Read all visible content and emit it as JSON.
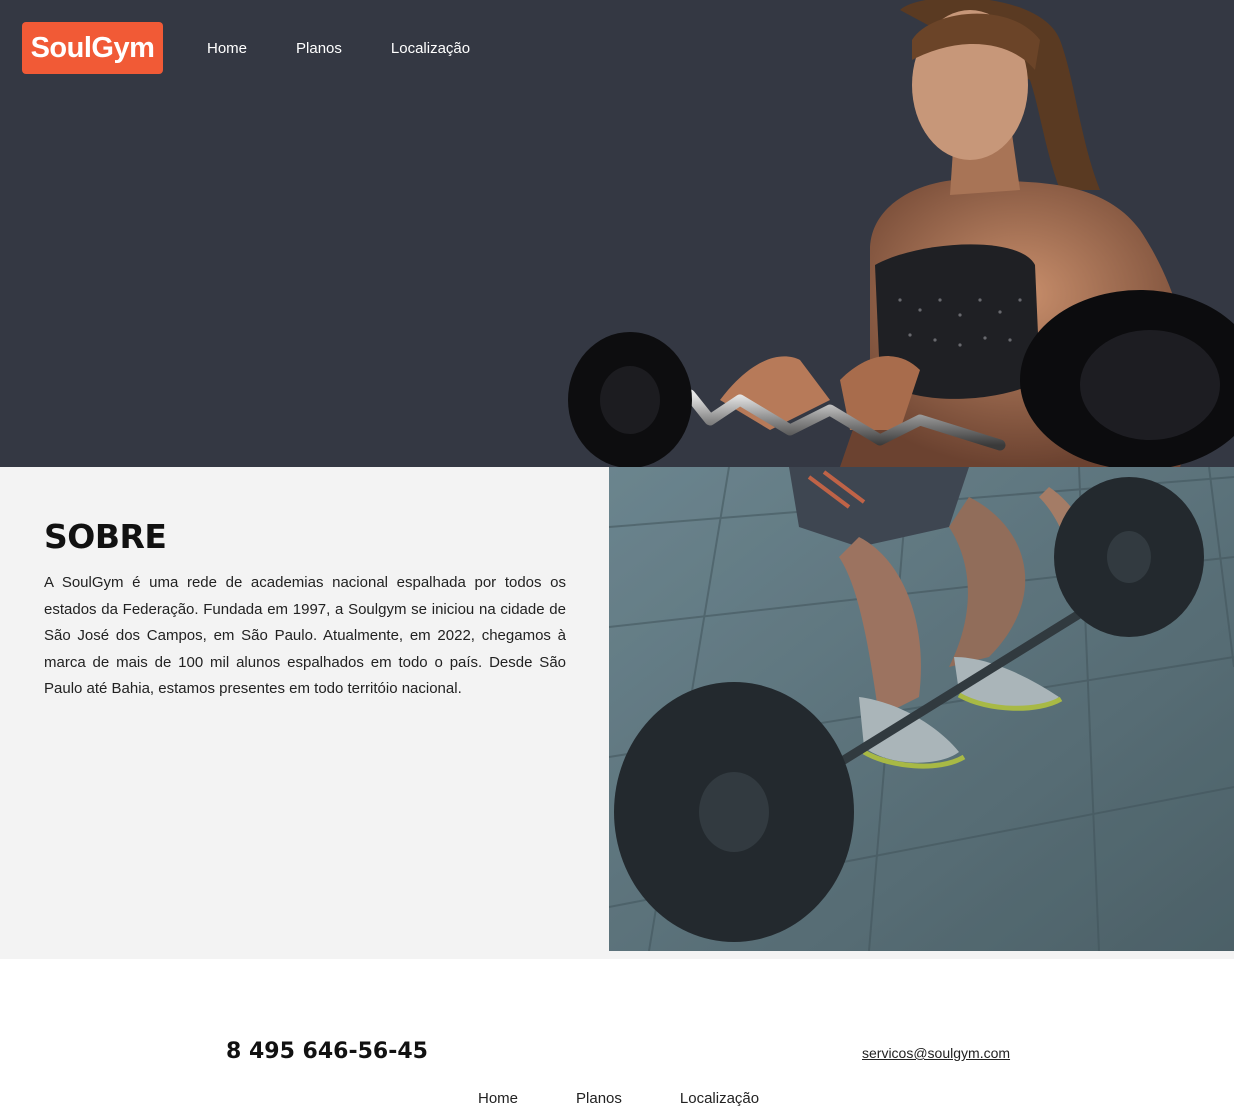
{
  "header": {
    "logo": "SoulGym",
    "nav": [
      "Home",
      "Planos",
      "Localização"
    ]
  },
  "about": {
    "title": "SOBRE",
    "body": "A SoulGym é uma rede de academias nacional espalhada por todos os estados da Federação. Fundada em 1997, a Soulgym se iniciou na cidade de São José dos Campos, em São Paulo. Atualmente, em 2022, chegamos à marca de mais de 100 mil alunos espalhados em todo o país. Desde São Paulo até Bahia, estamos presentes em todo territóio nacional."
  },
  "footer": {
    "phone": "8 495 646-56-45",
    "email": "servicos@soulgym.com",
    "nav": [
      "Home",
      "Planos",
      "Localização"
    ]
  },
  "colors": {
    "hero_bg": "#343843",
    "brand": "#f15a36",
    "about_bg": "#f3f3f3"
  }
}
